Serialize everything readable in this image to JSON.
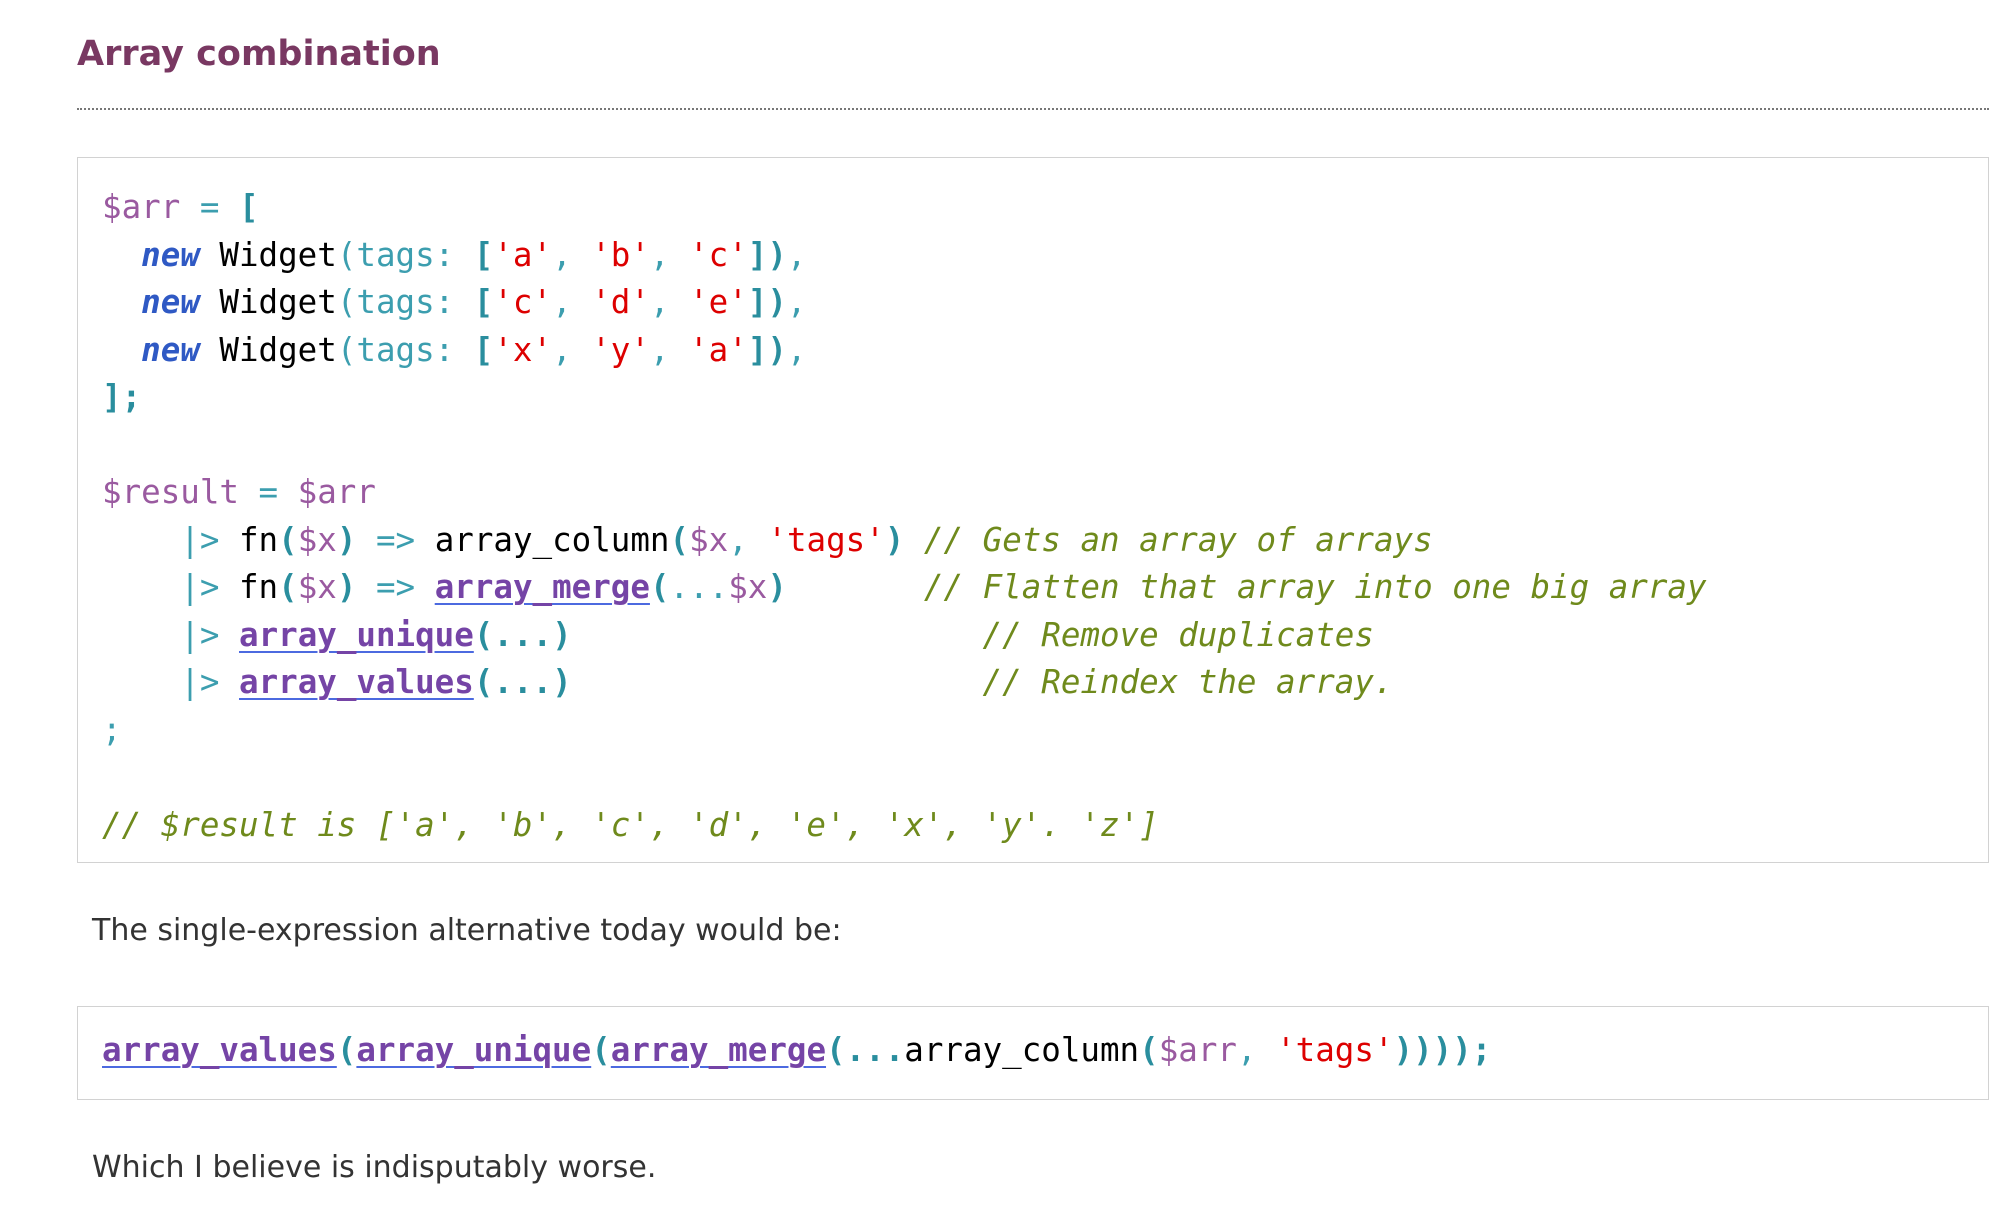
{
  "heading": "Array combination",
  "code_main": {
    "line1": {
      "var": "$arr",
      "eq": " = ",
      "open": "["
    },
    "widget_lines": [
      {
        "kw": "new",
        "cls": " Widget",
        "args": "(tags: ",
        "b_open": "[",
        "s1": "'a'",
        "s2": "'b'",
        "s3": "'c'",
        "b_close": "])",
        "end": ","
      },
      {
        "kw": "new",
        "cls": " Widget",
        "args": "(tags: ",
        "b_open": "[",
        "s1": "'c'",
        "s2": "'d'",
        "s3": "'e'",
        "b_close": "])",
        "end": ","
      },
      {
        "kw": "new",
        "cls": " Widget",
        "args": "(tags: ",
        "b_open": "[",
        "s1": "'x'",
        "s2": "'y'",
        "s3": "'a'",
        "b_close": "])",
        "end": ","
      }
    ],
    "close_line": "];",
    "result_line": {
      "var1": "$result",
      "eq": " = ",
      "var2": "$arr"
    },
    "pipe1": {
      "pipe": "|>",
      "fn": " fn",
      "p_open": "(",
      "param": "$x",
      "p_close": ")",
      "arrow": " => ",
      "call": "array_column",
      "c_open": "(",
      "arg1": "$x",
      "sep": ", ",
      "arg2": "'tags'",
      "c_close": ")",
      "comment": " // Gets an array of arrays"
    },
    "pipe2": {
      "pipe": "|>",
      "fn": " fn",
      "p_open": "(",
      "param": "$x",
      "p_close": ")",
      "arrow": " => ",
      "call": "array_merge",
      "c_open": "(",
      "spread": "...",
      "arg": "$x",
      "c_close": ")",
      "comment": "       // Flatten that array into one big array"
    },
    "pipe3": {
      "pipe": "|>",
      "call": "array_unique",
      "args": "(...)",
      "comment": "                     // Remove duplicates"
    },
    "pipe4": {
      "pipe": "|>",
      "call": "array_values",
      "args": "(...)",
      "comment": "                     // Reindex the array."
    },
    "semicolon": ";",
    "final_comment": "// $result is ['a', 'b', 'c', 'd', 'e', 'x', 'y'. 'z']"
  },
  "para1": "The single-expression alternative today would be:",
  "code_alt": {
    "f1": "array_values",
    "o1": "(",
    "f2": "array_unique",
    "o2": "(",
    "f3": "array_merge",
    "o3": "(...",
    "f4": "array_column",
    "o4": "(",
    "var": "$arr",
    "sep": ", ",
    "str": "'tags'",
    "close": "))));"
  },
  "para2": "Which I believe is indisputably worse.",
  "colors": {
    "heading": "#793862",
    "variable": "#9a5aa0",
    "keyword": "#2f59c4",
    "string": "#dd0000",
    "comment": "#6f8a1c",
    "bracket": "#2a8e9e",
    "function_link": "#7544a6"
  }
}
